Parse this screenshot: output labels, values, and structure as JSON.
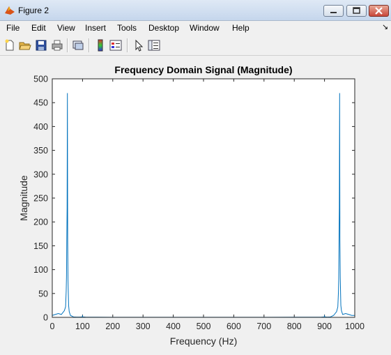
{
  "window": {
    "title": "Figure 2",
    "icon": "matlab-icon"
  },
  "window_controls": [
    "minimize-icon",
    "maximize-icon",
    "close-icon"
  ],
  "menu": [
    "File",
    "Edit",
    "View",
    "Insert",
    "Tools",
    "Desktop",
    "Window",
    "Help"
  ],
  "toolbar_icons": [
    "new-figure-icon",
    "open-file-icon",
    "save-icon",
    "print-icon",
    "link-icon",
    "colorbar-icon",
    "legend-icon",
    "pointer-icon",
    "property-editor-icon"
  ],
  "chart_data": {
    "type": "line",
    "title": "Frequency Domain Signal (Magnitude)",
    "xlabel": "Frequency (Hz)",
    "ylabel": "Magnitude",
    "xlim": [
      0,
      1000
    ],
    "ylim": [
      0,
      500
    ],
    "xticks": [
      0,
      100,
      200,
      300,
      400,
      500,
      600,
      700,
      800,
      900,
      1000
    ],
    "yticks": [
      0,
      50,
      100,
      150,
      200,
      250,
      300,
      350,
      400,
      450,
      500
    ],
    "grid": false,
    "line_color": "#0072bd",
    "series": [
      {
        "x": [
          0,
          10,
          20,
          30,
          40,
          44,
          46,
          47,
          48,
          49,
          50,
          51,
          52,
          53,
          54,
          56,
          60,
          70,
          80,
          90,
          99,
          100,
          101,
          110,
          150,
          200,
          300,
          400,
          500,
          600,
          700,
          800,
          890,
          899,
          900,
          901,
          910,
          920,
          930,
          940,
          944,
          946,
          947,
          948,
          949,
          950,
          951,
          952,
          953,
          954,
          956,
          960,
          970,
          980,
          990,
          1000
        ],
        "y": [
          4,
          6,
          8,
          6,
          14,
          22,
          55,
          85,
          162,
          230,
          470,
          160,
          80,
          52,
          25,
          12,
          4,
          1,
          0.5,
          0.5,
          1,
          3,
          1,
          0.5,
          0.3,
          0.2,
          0.2,
          0.2,
          0.2,
          0.2,
          0.2,
          0.3,
          0.5,
          1,
          3,
          1,
          0.5,
          1,
          4,
          12,
          22,
          52,
          80,
          160,
          230,
          470,
          162,
          85,
          55,
          25,
          14,
          6,
          8,
          6,
          4,
          4
        ]
      }
    ]
  }
}
